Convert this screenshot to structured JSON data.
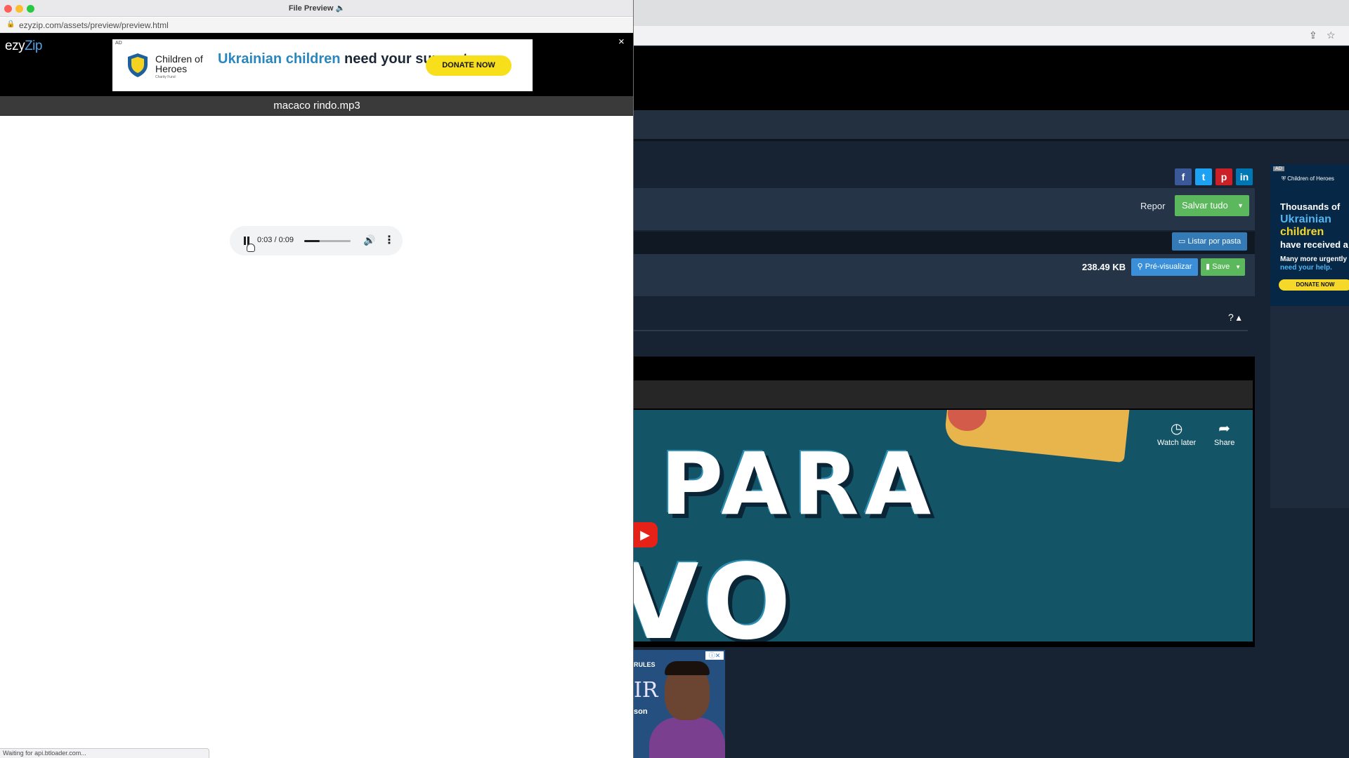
{
  "popup": {
    "window_title": "File Preview 🔈",
    "url": "ezyzip.com/assets/preview/preview.html",
    "brand": {
      "ezy": "ezy",
      "zip": "Zip"
    },
    "close_icon": "×",
    "file_name": "macaco rindo.mp3",
    "top_ad": {
      "tag": "AD",
      "org_name": "Children of Heroes",
      "org_sub": "Charity Fund",
      "headline_highlight": "Ukrainian children",
      "headline_rest": " need your support.",
      "button": "DONATE NOW"
    },
    "audio_player": {
      "time": "0:03 / 0:09",
      "progress": 0.33,
      "volume_icon": "volume-icon",
      "more_icon": "more-vertical-icon"
    },
    "status_text": "Waiting for api.btloader.com..."
  },
  "background_page": {
    "social": [
      "f",
      "t",
      "p",
      "in"
    ],
    "repor_label": "Repor",
    "salvar_label": "Salvar tudo",
    "listar_label": "Listar por pasta",
    "file_size": "238.49 KB",
    "preview_label": "Pré-visualizar",
    "save_label": "Save",
    "help_label": "? ▴",
    "video": {
      "line1": "PARA",
      "line2": "VO ORIGINAL",
      "watch_later": "Watch later",
      "share": "Share"
    },
    "side_ad": {
      "tag": "AD",
      "org": "Children of Heroes",
      "line1": "Thousands of",
      "highlight1": "Ukrainian",
      "highlight2": "children",
      "line2": "have received a",
      "sub1": "Many more urgently",
      "sub2": "need your help.",
      "button": "DONATE NOW"
    },
    "bottom_ad": {
      "rules": "RULES",
      "big_letters": "IR",
      "name": "son"
    }
  },
  "colors": {
    "accent_green": "#5cb85c",
    "accent_blue": "#337ab7",
    "facebook": "#3b5998",
    "twitter": "#1da1f2",
    "pinterest": "#cb2027",
    "linkedin": "#0077b5",
    "donate_yellow": "#f8df1c"
  }
}
